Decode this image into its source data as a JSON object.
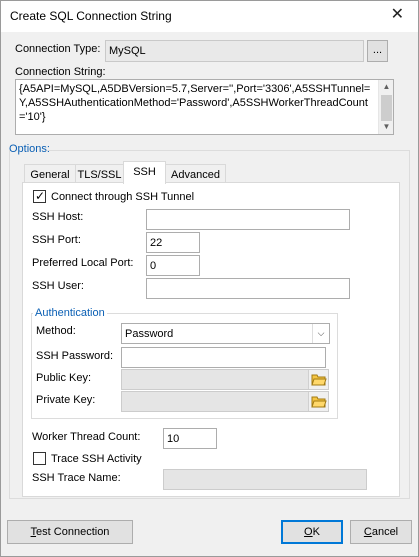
{
  "window": {
    "title": "Create SQL Connection String",
    "close_glyph": "✕"
  },
  "connection": {
    "type_label": "Connection Type:",
    "type_value": "MySQL",
    "browse_label": "...",
    "string_label": "Connection String:",
    "string_value": "{A5API=MySQL,A5DBVersion=5.7,Server='',Port='3306',A5SSHTunnel=Y,A5SSHAuthenticationMethod='Password',A5SSHWorkerThreadCount='10'}"
  },
  "options": {
    "label": "Options:",
    "tabs": [
      {
        "label": "General",
        "active": false
      },
      {
        "label": "TLS/SSL",
        "active": false
      },
      {
        "label": "SSH",
        "active": true
      },
      {
        "label": "Advanced",
        "active": false
      }
    ]
  },
  "ssh": {
    "tunnel_label": "Connect through SSH Tunnel",
    "tunnel_checked": true,
    "host_label": "SSH Host:",
    "host_value": "",
    "port_label": "SSH Port:",
    "port_value": "22",
    "local_port_label": "Preferred Local Port:",
    "local_port_value": "0",
    "user_label": "SSH User:",
    "user_value": ""
  },
  "auth": {
    "legend": "Authentication",
    "method_label": "Method:",
    "method_value": "Password",
    "password_label": "SSH Password:",
    "password_value": "",
    "public_key_label": "Public Key:",
    "public_key_value": "",
    "private_key_label": "Private Key:",
    "private_key_value": ""
  },
  "worker": {
    "thread_count_label": "Worker Thread Count:",
    "thread_count_value": "10",
    "trace_label": "Trace SSH Activity",
    "trace_checked": false,
    "trace_name_label": "SSH Trace Name:",
    "trace_name_value": ""
  },
  "footer": {
    "test_label_ul": "T",
    "test_label_rest": "est Connection",
    "ok_label_ul": "O",
    "ok_label_rest": "K",
    "cancel_label_ul": "C",
    "cancel_label_rest": "ancel"
  },
  "colors": {
    "accent": "#0078d7",
    "group_legend": "#0a5fb4"
  },
  "icons": {
    "folder": "folder-open-icon",
    "dropdown": "chevron-down-icon",
    "checkmark": "checkmark-icon"
  }
}
